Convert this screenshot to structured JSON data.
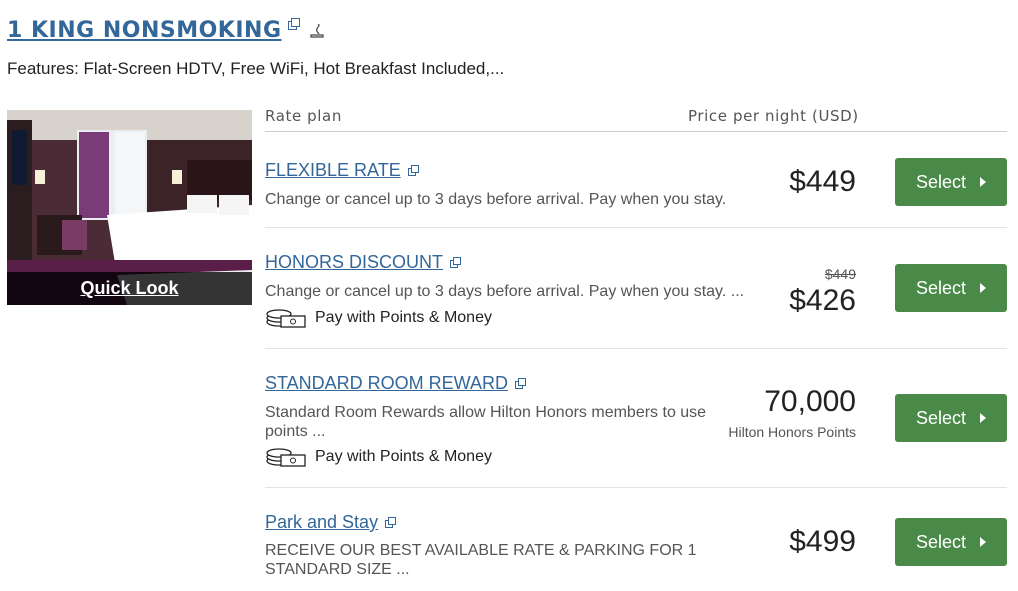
{
  "room": {
    "title": "1 KING NONSMOKING",
    "features": "Features: Flat-Screen HDTV, Free WiFi, Hot Breakfast Included,...",
    "quick_look": "Quick Look"
  },
  "table": {
    "header_plan": "Rate plan",
    "header_price": "Price per night (USD)"
  },
  "rates": [
    {
      "name": "FLEXIBLE RATE",
      "description": "Change or cancel up to 3 days before arrival. Pay when you stay.",
      "price": "$449",
      "select_label": "Select"
    },
    {
      "name": "HONORS DISCOUNT",
      "description": "Change or cancel up to 3 days before arrival. Pay when you stay. ...",
      "points_money": "Pay with Points & Money",
      "old_price": "$449",
      "price": "$426",
      "select_label": "Select"
    },
    {
      "name": "STANDARD ROOM REWARD",
      "description_line1": "Standard Room Rewards allow Hilton Honors members to use",
      "description_line2": "points ...",
      "points_money": "Pay with Points & Money",
      "price": "70,000",
      "price_unit": "Hilton Honors Points",
      "select_label": "Select"
    },
    {
      "name": "Park and Stay",
      "description_line1": "RECEIVE OUR BEST AVAILABLE RATE & PARKING FOR 1",
      "description_line2": "STANDARD SIZE ...",
      "price": "$499",
      "select_label": "Select"
    }
  ],
  "colors": {
    "link": "#336699",
    "select_button": "#4a8a49"
  }
}
